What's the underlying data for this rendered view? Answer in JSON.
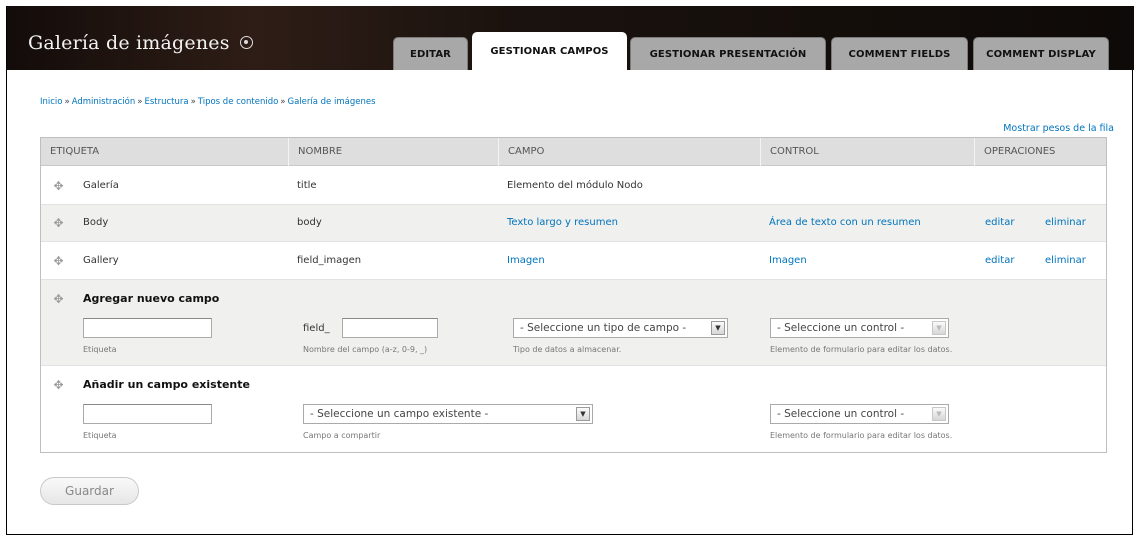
{
  "header": {
    "title": "Galería de imágenes",
    "tabs": [
      {
        "label": "EDITAR",
        "active": false
      },
      {
        "label": "GESTIONAR CAMPOS",
        "active": true
      },
      {
        "label": "GESTIONAR PRESENTACIÓN",
        "active": false
      },
      {
        "label": "COMMENT FIELDS",
        "active": false
      },
      {
        "label": "COMMENT DISPLAY",
        "active": false
      }
    ]
  },
  "breadcrumb": [
    "Inicio",
    "Administración",
    "Estructura",
    "Tipos de contenido",
    "Galería de imágenes"
  ],
  "breadcrumb_separator": "»",
  "row_weights_link": "Mostrar pesos de la fila",
  "table": {
    "headers": [
      "ETIQUETA",
      "NOMBRE",
      "CAMPO",
      "CONTROL",
      "OPERACIONES"
    ],
    "rows": [
      {
        "label": "Galería",
        "name": "title",
        "field": "Elemento del módulo Nodo",
        "widget": "",
        "edit": "",
        "delete": ""
      },
      {
        "label": "Body",
        "name": "body",
        "field": "Texto largo y resumen",
        "widget": "Área de texto con un resumen",
        "edit": "editar",
        "delete": "eliminar"
      },
      {
        "label": "Gallery",
        "name": "field_imagen",
        "field": "Imagen",
        "widget": "Imagen",
        "edit": "editar",
        "delete": "eliminar"
      }
    ],
    "add_new": {
      "title": "Agregar nuevo campo",
      "label_desc": "Etiqueta",
      "name_prefix": "field_",
      "name_desc": "Nombre del campo (a-z, 0-9, _)",
      "type_select": "- Seleccione un tipo de campo -",
      "type_desc": "Tipo de datos a almacenar.",
      "widget_select": "- Seleccione un control -",
      "widget_desc": "Elemento de formulario para editar los datos."
    },
    "add_existing": {
      "title": "Añadir un campo existente",
      "label_desc": "Etiqueta",
      "field_select": "- Seleccione un campo existente -",
      "field_desc": "Campo a compartir",
      "widget_select": "- Seleccione un control -",
      "widget_desc": "Elemento de formulario para editar los datos."
    }
  },
  "save_button": "Guardar",
  "colors": {
    "link": "#0074bd",
    "header_bg": "#1a120e",
    "tab_bg": "#a8a8a8"
  },
  "icons": {
    "title": "circle-plus-icon",
    "drag": "drag-handle-icon",
    "select": "dropdown-arrow-icon"
  }
}
